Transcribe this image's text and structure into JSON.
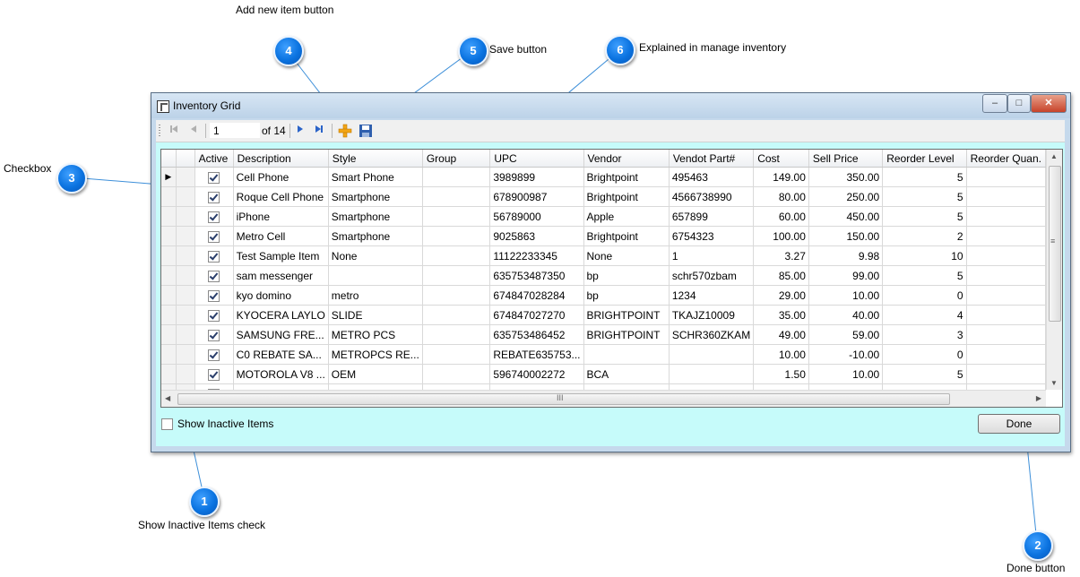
{
  "window": {
    "title": "Inventory Grid",
    "controls": [
      "–",
      "□",
      "✕"
    ]
  },
  "toolbar": {
    "page_value": "1",
    "page_of": "of 14",
    "icons": [
      "first-page-icon",
      "prev-page-icon",
      "next-page-icon",
      "last-page-icon",
      "add-item-icon",
      "save-icon"
    ]
  },
  "grid": {
    "columns": [
      "Active",
      "Description",
      "Style",
      "Group",
      "UPC",
      "Vendor",
      "Vendot Part#",
      "Cost",
      "Sell Price",
      "Reorder Level",
      "Reorder Quan."
    ],
    "rows": [
      {
        "active": true,
        "cells": [
          "Cell Phone",
          "Smart Phone",
          "",
          "3989899",
          "Brightpoint",
          "495463",
          "149.00",
          "350.00",
          "5",
          ""
        ]
      },
      {
        "active": true,
        "cells": [
          "Roque Cell Phone",
          "Smartphone",
          "",
          "678900987",
          "Brightpoint",
          "4566738990",
          "80.00",
          "250.00",
          "5",
          ""
        ]
      },
      {
        "active": true,
        "cells": [
          "iPhone",
          "Smartphone",
          "",
          "56789000",
          "Apple",
          "657899",
          "60.00",
          "450.00",
          "5",
          ""
        ]
      },
      {
        "active": true,
        "cells": [
          "Metro Cell",
          "Smartphone",
          "",
          "9025863",
          "Brightpoint",
          "6754323",
          "100.00",
          "150.00",
          "2",
          ""
        ]
      },
      {
        "active": true,
        "cells": [
          "Test Sample Item",
          "None",
          "",
          "11122233345",
          "None",
          "1",
          "3.27",
          "9.98",
          "10",
          ""
        ]
      },
      {
        "active": true,
        "cells": [
          "sam messenger",
          "",
          "",
          "635753487350",
          "bp",
          "schr570zbam",
          "85.00",
          "99.00",
          "5",
          ""
        ]
      },
      {
        "active": true,
        "cells": [
          "kyo domino",
          "metro",
          "",
          "674847028284",
          "bp",
          "1234",
          "29.00",
          "10.00",
          "0",
          ""
        ]
      },
      {
        "active": true,
        "cells": [
          "KYOCERA LAYLO",
          "SLIDE",
          "",
          "674847027270",
          "BRIGHTPOINT",
          "TKAJZ10009",
          "35.00",
          "40.00",
          "4",
          ""
        ]
      },
      {
        "active": true,
        "cells": [
          "SAMSUNG FRE...",
          "METRO PCS",
          "",
          "635753486452",
          "BRIGHTPOINT",
          "SCHR360ZKAM",
          "49.00",
          "59.00",
          "3",
          ""
        ]
      },
      {
        "active": true,
        "cells": [
          "C0 REBATE SA...",
          "METROPCS RE...",
          "",
          "REBATE635753...",
          "",
          "",
          "10.00",
          "-10.00",
          "0",
          ""
        ]
      },
      {
        "active": true,
        "cells": [
          "MOTOROLA V8 ...",
          "OEM",
          "",
          "596740002272",
          "BCA",
          "",
          "1.50",
          "10.00",
          "5",
          ""
        ]
      }
    ],
    "scroll_grip": "III",
    "vscroll_grip": "≡"
  },
  "footer": {
    "show_inactive_label": "Show Inactive Items",
    "show_inactive_checked": false,
    "done_label": "Done"
  },
  "callouts": {
    "c1": {
      "number": "1",
      "label": "Show Inactive Items check"
    },
    "c2": {
      "number": "2",
      "label": "Done button"
    },
    "c3": {
      "number": "3",
      "label": "Checkbox"
    },
    "c4": {
      "number": "4",
      "label": "Add new item button"
    },
    "c5": {
      "number": "5",
      "label": "Save button"
    },
    "c6": {
      "number": "6",
      "label": "Explained in manage inventory"
    }
  },
  "colors": {
    "badge": "#0b73e0",
    "client_bg": "#c6fbfa",
    "leader": "#3d8fd9"
  }
}
